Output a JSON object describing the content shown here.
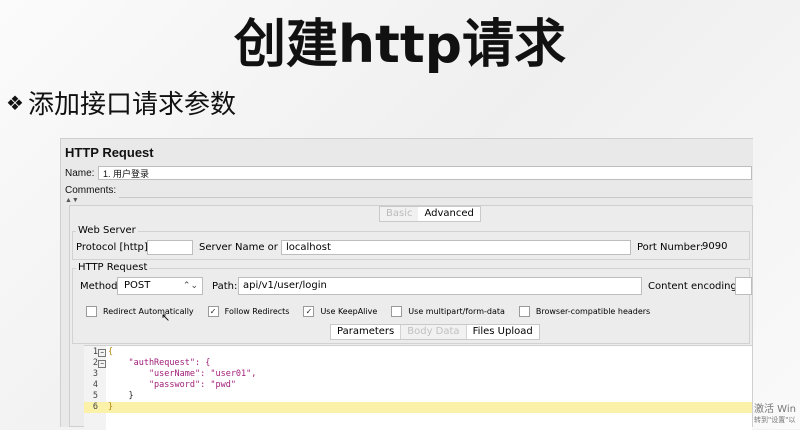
{
  "slide": {
    "title": "创建http请求",
    "bullet": "添加接口请求参数"
  },
  "window": {
    "title": "HTTP Request",
    "name_label": "Name:",
    "name_value": "1. 用户登录",
    "comments_label": "Comments:",
    "tabs": [
      "Basic",
      "Advanced"
    ]
  },
  "web_server": {
    "group_label": "Web Server",
    "protocol_label": "Protocol [http]:",
    "protocol_value": "",
    "server_label": "Server Name or IP:",
    "server_value": "localhost",
    "port_label": "Port Number:",
    "port_value": "9090"
  },
  "http_request": {
    "group_label": "HTTP Request",
    "method_label": "Method:",
    "method_value": "POST",
    "path_label": "Path:",
    "path_value": "api/v1/user/login",
    "encoding_label": "Content encoding:",
    "encoding_value": ""
  },
  "checkboxes": [
    {
      "label": "Redirect Automatically",
      "checked": false
    },
    {
      "label": "Follow Redirects",
      "checked": true
    },
    {
      "label": "Use KeepAlive",
      "checked": true
    },
    {
      "label": "Use multipart/form-data",
      "checked": false
    },
    {
      "label": "Browser-compatible headers",
      "checked": false
    }
  ],
  "subtabs": [
    "Parameters",
    "Body Data",
    "Files Upload"
  ],
  "body_lines": [
    {
      "num": "1",
      "text": "{"
    },
    {
      "num": "2",
      "text": "    \"authRequest\": {"
    },
    {
      "num": "3",
      "text": "        \"userName\": \"user01\","
    },
    {
      "num": "4",
      "text": "        \"password\": \"pwd\""
    },
    {
      "num": "5",
      "text": "    }"
    },
    {
      "num": "6",
      "text": "}"
    }
  ],
  "watermark": {
    "line1": "激活 Win",
    "line2": "转到\"设置\"以"
  }
}
